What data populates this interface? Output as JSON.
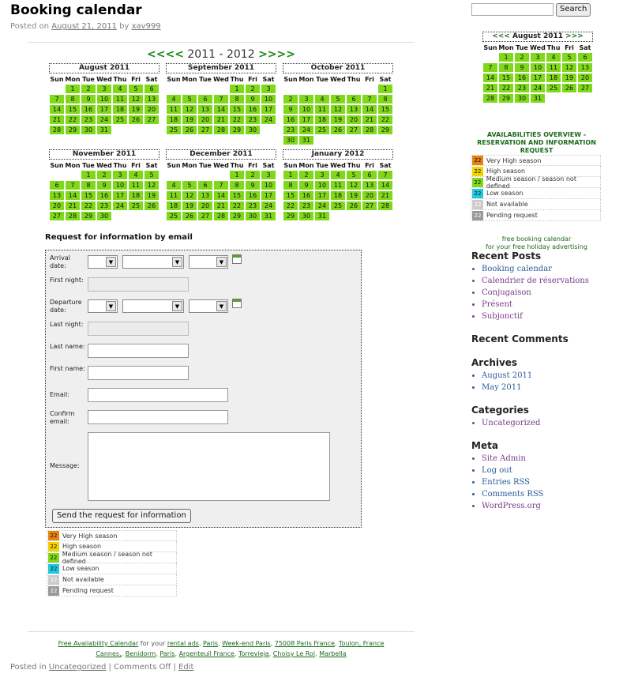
{
  "post": {
    "title": "Booking calendar",
    "meta_prefix": "Posted on ",
    "date": "August 21, 2011",
    "by": " by ",
    "author": "xav999",
    "footer_prefix": "Posted in ",
    "category": "Uncategorized",
    "sep1": " | ",
    "comments": "Comments Off",
    "sep2": " | ",
    "edit": "Edit"
  },
  "calendar_nav": {
    "prev": "<<<<",
    "label": "2011 - 2012",
    "next": ">>>>"
  },
  "weekdays": [
    "Sun",
    "Mon",
    "Tue",
    "Wed",
    "Thu",
    "Fri",
    "Sat"
  ],
  "months": [
    {
      "name": "August 2011",
      "offset": 1,
      "days": 31
    },
    {
      "name": "September 2011",
      "offset": 4,
      "days": 30
    },
    {
      "name": "October 2011",
      "offset": 6,
      "days": 31
    },
    {
      "name": "November 2011",
      "offset": 2,
      "days": 30
    },
    {
      "name": "December 2011",
      "offset": 4,
      "days": 31
    },
    {
      "name": "January 2012",
      "offset": 0,
      "days": 31
    }
  ],
  "form": {
    "heading": "Request for information by email",
    "arrival_label": "Arrival date:",
    "first_night_label": "First night:",
    "departure_label": "Departure date:",
    "last_night_label": "Last night:",
    "last_name_label": "Last name:",
    "first_name_label": "First name:",
    "email_label": "Email:",
    "confirm_email_label": "Confirm email:",
    "message_label": "Message:",
    "submit": "Send the request for information"
  },
  "legend": [
    {
      "num": "22",
      "label": "Very High season",
      "color": "#e8820e"
    },
    {
      "num": "22",
      "label": "High season",
      "color": "#f2d200"
    },
    {
      "num": "22",
      "label": "Medium season / season not defined",
      "color": "#7fd81a"
    },
    {
      "num": "22",
      "label": "Low season",
      "color": "#1ec8e0"
    },
    {
      "num": "22",
      "label": "Not available",
      "color": "#cccccc"
    },
    {
      "num": "22",
      "label": "Pending request",
      "color": "#999999"
    }
  ],
  "footer": {
    "link1": "Free Availability Calendar",
    "text1": " for your ",
    "links_line1": [
      "rental ads",
      "Paris",
      "Week-end Paris",
      "75008 Paris France",
      "Toulon, France"
    ],
    "links_line2": [
      "Cannes,",
      "Benidorm",
      "Paris",
      "Argenteuil France",
      "Torrevieja",
      "Choisy Le Roi",
      "Marbella"
    ]
  },
  "sidebar": {
    "search_button": "Search",
    "mini_calendar": {
      "prev": "<<<",
      "name": "August 2011",
      "next": ">>>",
      "offset": 1,
      "days": 31
    },
    "availabilities_title": "AVAILABILITIES OVERVIEW - RESERVATION AND INFORMATION REQUEST",
    "free_line1": "free booking calendar",
    "free_line2": "for your free holiday advertising",
    "recent_posts_title": "Recent Posts",
    "recent_posts": [
      "Booking calendar",
      "Calendrier de réservations",
      "Conjugaison",
      "Présent",
      "Subjonctif"
    ],
    "recent_comments_title": "Recent Comments",
    "archives_title": "Archives",
    "archives": [
      "August 2011",
      "May 2011"
    ],
    "categories_title": "Categories",
    "categories": [
      "Uncategorized"
    ],
    "meta_title": "Meta",
    "meta": [
      "Site Admin",
      "Log out",
      "Entries RSS",
      "Comments RSS",
      "WordPress.org"
    ]
  }
}
